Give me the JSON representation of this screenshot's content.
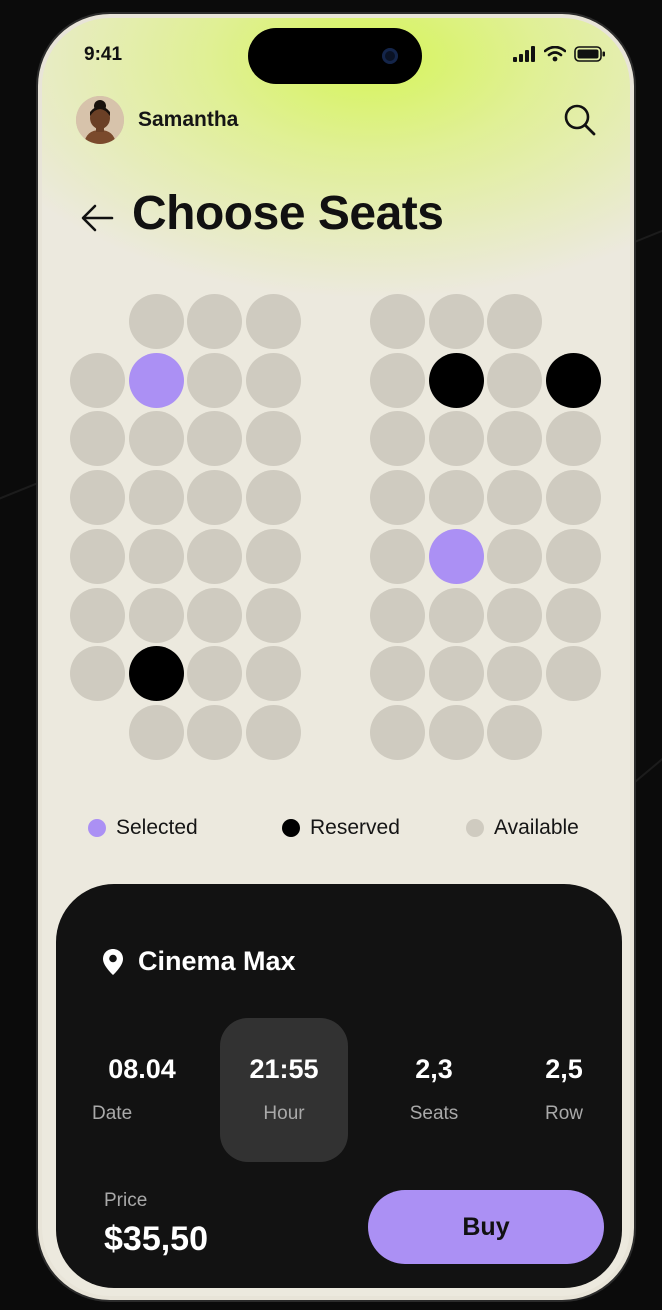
{
  "status_bar": {
    "time": "9:41"
  },
  "header": {
    "user_name": "Samantha",
    "icons": {
      "search": "search-icon",
      "back": "arrow-left-icon"
    }
  },
  "page": {
    "title": "Choose Seats"
  },
  "seat_map": {
    "left_block": [
      [
        "none",
        "available",
        "available",
        "available"
      ],
      [
        "available",
        "selected",
        "available",
        "available"
      ],
      [
        "available",
        "available",
        "available",
        "available"
      ],
      [
        "available",
        "available",
        "available",
        "available"
      ],
      [
        "available",
        "available",
        "available",
        "available"
      ],
      [
        "available",
        "available",
        "available",
        "available"
      ],
      [
        "available",
        "reserved",
        "available",
        "available"
      ],
      [
        "none",
        "available",
        "available",
        "available"
      ]
    ],
    "right_block": [
      [
        "available",
        "available",
        "available",
        "none"
      ],
      [
        "available",
        "reserved",
        "available",
        "reserved"
      ],
      [
        "available",
        "available",
        "available",
        "available"
      ],
      [
        "available",
        "available",
        "available",
        "available"
      ],
      [
        "available",
        "selected",
        "available",
        "available"
      ],
      [
        "available",
        "available",
        "available",
        "available"
      ],
      [
        "available",
        "available",
        "available",
        "available"
      ],
      [
        "available",
        "available",
        "available",
        "none"
      ]
    ],
    "colors": {
      "available": "#cfcbc0",
      "reserved": "#000000",
      "selected": "#ab90f4"
    }
  },
  "legend": {
    "selected": "Selected",
    "reserved": "Reserved",
    "available": "Available"
  },
  "booking": {
    "cinema": "Cinema Max",
    "date_value": "08.04",
    "date_label": "Date",
    "hour_value": "21:55",
    "hour_label": "Hour",
    "seats_value": "2,3",
    "seats_label": "Seats",
    "row_value": "2,5",
    "row_label": "Row",
    "price_label": "Price",
    "price_value": "$35,50",
    "buy_label": "Buy"
  },
  "colors": {
    "accent": "#ab90f4",
    "highlight": "#d6f55a",
    "card": "#121212"
  }
}
